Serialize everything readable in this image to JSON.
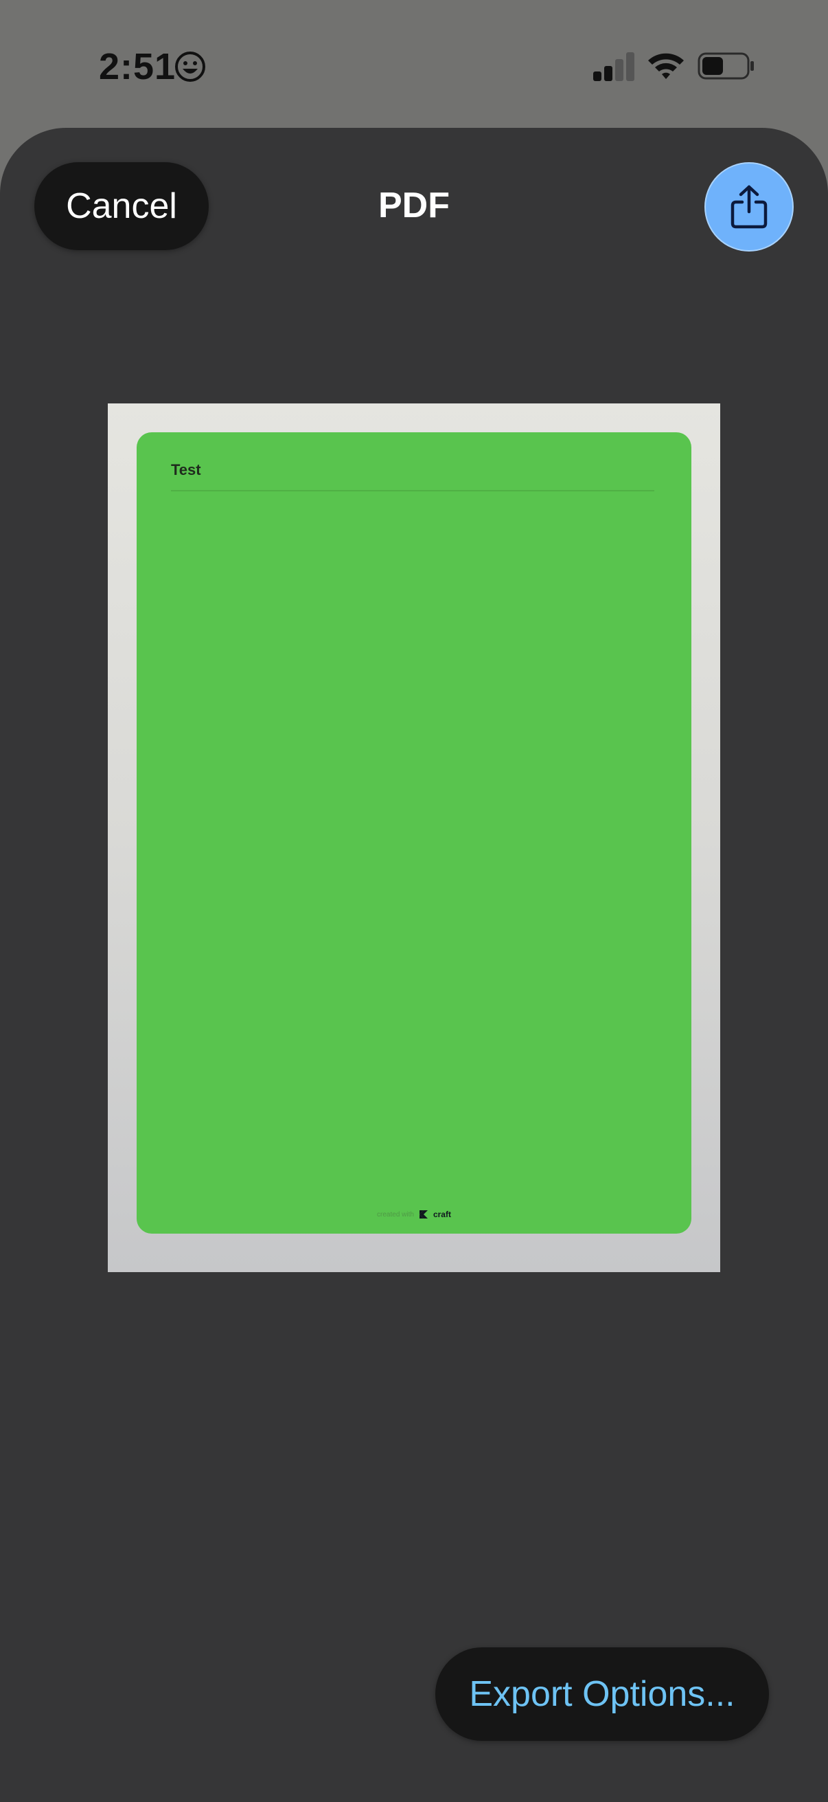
{
  "status_bar": {
    "time": "2:51",
    "emoji_icon": "smiley-face-icon",
    "signal_icon": "cellular-signal-icon",
    "wifi_icon": "wifi-icon",
    "battery_icon": "battery-icon"
  },
  "sheet": {
    "cancel_label": "Cancel",
    "title": "PDF",
    "share_icon": "share-icon"
  },
  "preview": {
    "document_title": "Test",
    "footer_prefix": "created with",
    "footer_brand": "craft",
    "card_color": "#59c44e"
  },
  "footer": {
    "export_options_label": "Export Options..."
  },
  "colors": {
    "accent_blue": "#6fb2fb",
    "link_blue": "#6ec3f4",
    "sheet_background": "#363637"
  }
}
